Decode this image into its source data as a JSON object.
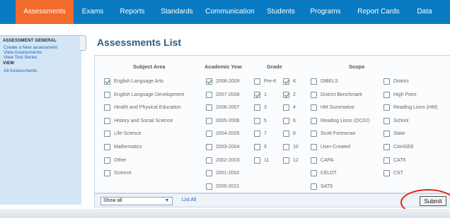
{
  "nav": {
    "tabs": [
      {
        "label": "Assessments",
        "active": true
      },
      {
        "label": "Exams"
      },
      {
        "label": "Reports"
      },
      {
        "label": "Standards"
      },
      {
        "label": "Communication"
      },
      {
        "label": "Students"
      },
      {
        "label": "Programs"
      },
      {
        "label": "Report Cards"
      },
      {
        "label": "Data"
      }
    ]
  },
  "sidebar": {
    "group1_title": "ASSESSMENT GENERAL",
    "links1": [
      "Create a New assessment",
      "View Assessments",
      "View Test Series"
    ],
    "group2_title": "VIEW",
    "links2": [
      "All Assessments"
    ]
  },
  "main": {
    "title": "Assessments List",
    "headers": {
      "subject": "Subject Area",
      "year": "Academic Year",
      "grade": "Grade",
      "scope": "Scope"
    },
    "subjects": [
      {
        "label": "English Language Arts",
        "checked": true
      },
      {
        "label": "English Language Development",
        "checked": false
      },
      {
        "label": "Health and Physical Education",
        "checked": false
      },
      {
        "label": "History and Social Science",
        "checked": false
      },
      {
        "label": "Life-Science",
        "checked": false
      },
      {
        "label": "Mathematics",
        "checked": false
      },
      {
        "label": "Other",
        "checked": false
      },
      {
        "label": "Science",
        "checked": false
      }
    ],
    "years": [
      {
        "label": "2008-2009",
        "checked": true
      },
      {
        "label": "2007-2008",
        "checked": false
      },
      {
        "label": "2006-2007",
        "checked": false
      },
      {
        "label": "2005-2006",
        "checked": false
      },
      {
        "label": "2004-2005",
        "checked": false
      },
      {
        "label": "2003-2004",
        "checked": false
      },
      {
        "label": "2002-2003",
        "checked": false
      },
      {
        "label": "2001-2002",
        "checked": false
      },
      {
        "label": "2000-2021",
        "checked": false
      }
    ],
    "grades_a": [
      {
        "label": "Pre-K",
        "checked": false
      },
      {
        "label": "1",
        "checked": true
      },
      {
        "label": "3",
        "checked": false
      },
      {
        "label": "5",
        "checked": false
      },
      {
        "label": "7",
        "checked": false
      },
      {
        "label": "9",
        "checked": false
      },
      {
        "label": "11",
        "checked": false
      }
    ],
    "grades_b": [
      {
        "label": "K",
        "checked": true
      },
      {
        "label": "2",
        "checked": true
      },
      {
        "label": "4",
        "checked": false
      },
      {
        "label": "6",
        "checked": false
      },
      {
        "label": "8",
        "checked": false
      },
      {
        "label": "10",
        "checked": false
      },
      {
        "label": "12",
        "checked": false
      }
    ],
    "scope_a": [
      {
        "label": "DIBELS",
        "checked": false
      },
      {
        "label": "District Benchmark",
        "checked": false
      },
      {
        "label": "HM Summative",
        "checked": false
      },
      {
        "label": "Reading Lions (OC02)",
        "checked": false
      },
      {
        "label": "Scott Foresman",
        "checked": false
      },
      {
        "label": "User-Created",
        "checked": false
      },
      {
        "label": "CAPA",
        "checked": false
      },
      {
        "label": "CELDT",
        "checked": false
      },
      {
        "label": "SAT9",
        "checked": false
      }
    ],
    "scope_b": [
      {
        "label": "District",
        "checked": false
      },
      {
        "label": "High Point",
        "checked": false
      },
      {
        "label": "Reading Lions (HM)",
        "checked": false
      },
      {
        "label": "School",
        "checked": false
      },
      {
        "label": "State",
        "checked": false
      },
      {
        "label": "CAHSEE",
        "checked": false
      },
      {
        "label": "CAT6",
        "checked": false
      },
      {
        "label": "CST",
        "checked": false
      }
    ],
    "footer": {
      "show_select": "Show all",
      "list_all": "List All",
      "submit": "Submit"
    }
  },
  "colors": {
    "nav_bg": "#0a7bc2",
    "active_tab": "#f26a2c",
    "title": "#2b5d84",
    "annotation": "#e0201a"
  }
}
